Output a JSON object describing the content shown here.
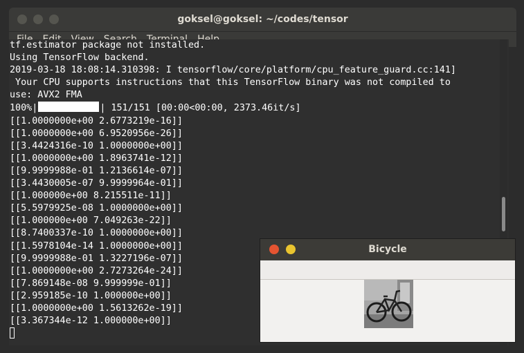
{
  "terminal": {
    "title": "goksel@goksel: ~/codes/tensor",
    "menu": [
      "File",
      "Edit",
      "View",
      "Search",
      "Terminal",
      "Help"
    ],
    "lines": [
      "tf.estimator package not installed.",
      "Using TensorFlow backend.",
      "2019-03-18 18:08:14.310398: I tensorflow/core/platform/cpu_feature_guard.cc:141]",
      " Your CPU supports instructions that this TensorFlow binary was not compiled to",
      "use: AVX2 FMA"
    ],
    "progress": {
      "percent": "100%|",
      "suffix": "| 151/151 [00:00<00:00, 2373.46it/s]",
      "fill": 1.0
    },
    "outputs": [
      "[[1.0000000e+00 2.6773219e-16]]",
      "[[1.0000000e+00 6.9520956e-26]]",
      "[[3.4424316e-10 1.0000000e+00]]",
      "[[1.0000000e+00 1.8963741e-12]]",
      "[[9.9999988e-01 1.2136614e-07]]",
      "[[3.4430005e-07 9.9999964e-01]]",
      "[[1.000000e+00 8.215511e-11]]",
      "[[5.5979925e-08 1.0000000e+00]]",
      "[[1.000000e+00 7.049263e-22]]",
      "[[8.7400337e-10 1.0000000e+00]]",
      "[[1.5978104e-14 1.0000000e+00]]",
      "[[9.9999988e-01 1.3227196e-07]]",
      "[[1.0000000e+00 2.7273264e-24]]",
      "[[7.869148e-08 9.999999e-01]]",
      "[[2.959185e-10 1.000000e+00]]",
      "[[1.0000000e+00 1.5613262e-19]]",
      "[[3.367344e-12 1.000000e+00]]"
    ]
  },
  "bicycle_window": {
    "title": "Bicycle"
  },
  "colors": {
    "terminal_bg": "#2f2f2f",
    "titlebar": "#3a3a38",
    "close_red": "#e55431",
    "minimize_yellow": "#e9c42f"
  }
}
